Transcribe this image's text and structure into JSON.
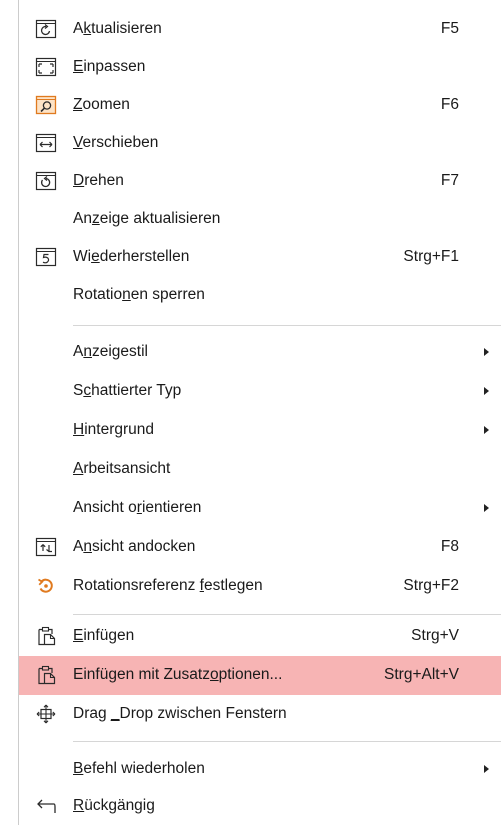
{
  "menu": {
    "items": [
      {
        "pre": "A",
        "acc": "k",
        "post": "tualisieren",
        "shortcut": "F5",
        "icon": "refresh-icon"
      },
      {
        "pre": "",
        "acc": "E",
        "post": "inpassen",
        "shortcut": "",
        "icon": "fit-icon"
      },
      {
        "pre": "",
        "acc": "Z",
        "post": "oomen",
        "shortcut": "F6",
        "icon": "zoom-icon"
      },
      {
        "pre": "",
        "acc": "V",
        "post": "erschieben",
        "shortcut": "",
        "icon": "pan-icon"
      },
      {
        "pre": "",
        "acc": "D",
        "post": "rehen",
        "shortcut": "F7",
        "icon": "rotate-icon"
      },
      {
        "pre": "An",
        "acc": "z",
        "post": "eige aktualisieren",
        "shortcut": "",
        "icon": ""
      },
      {
        "pre": "Wi",
        "acc": "e",
        "post": "derherstellen",
        "shortcut": "Strg+F1",
        "icon": "restore-icon"
      },
      {
        "pre": "Rotatio",
        "acc": "n",
        "post": "en sperren",
        "shortcut": "",
        "icon": ""
      },
      {
        "pre": "A",
        "acc": "n",
        "post": "zeigestil",
        "shortcut": "",
        "icon": ""
      },
      {
        "pre": "S",
        "acc": "c",
        "post": "hattierter Typ",
        "shortcut": "",
        "icon": ""
      },
      {
        "pre": "",
        "acc": "H",
        "post": "intergrund",
        "shortcut": "",
        "icon": ""
      },
      {
        "pre": "",
        "acc": "A",
        "post": "rbeitsansicht",
        "shortcut": "",
        "icon": ""
      },
      {
        "pre": "Ansicht o",
        "acc": "r",
        "post": "ientieren",
        "shortcut": "",
        "icon": ""
      },
      {
        "pre": "A",
        "acc": "n",
        "post": "sicht andocken",
        "shortcut": "F8",
        "icon": "dock-icon"
      },
      {
        "pre": "Rotationsreferenz ",
        "acc": "f",
        "post": "estlegen",
        "shortcut": "Strg+F2",
        "icon": "rotation-reference-icon"
      },
      {
        "pre": "",
        "acc": "E",
        "post": "infügen",
        "shortcut": "Strg+V",
        "icon": "paste-icon"
      },
      {
        "pre": "Einfügen mit Zusatz",
        "acc": "o",
        "post": "ptionen...",
        "shortcut": "Strg+Alt+V",
        "icon": "paste-special-icon"
      },
      {
        "pre": "Drag ",
        "acc": "_",
        "post": "Drop zwischen Fenstern",
        "shortcut": "",
        "icon": "drag-drop-icon"
      },
      {
        "pre": "",
        "acc": "B",
        "post": "efehl wiederholen",
        "shortcut": "",
        "icon": ""
      },
      {
        "pre": "",
        "acc": "R",
        "post": "ückgängig",
        "shortcut": "",
        "icon": "undo-icon"
      }
    ]
  },
  "colors": {
    "highlight": "#f7b4b4",
    "icon_stroke": "#2b2b2b",
    "zoom_accent": "#e07a1f",
    "rotation_accent": "#e07a1f"
  }
}
